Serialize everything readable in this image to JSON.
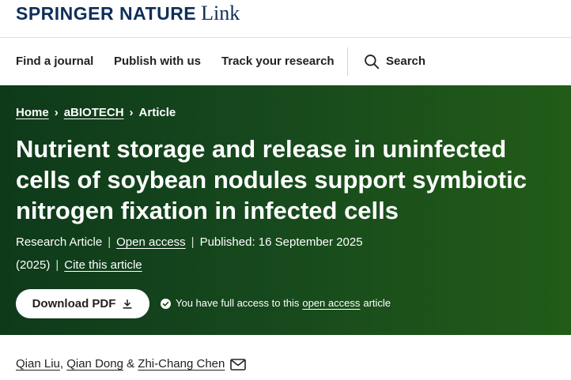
{
  "logo": {
    "brand": "SPRINGER NATURE",
    "sub": "Link"
  },
  "nav": {
    "items": [
      "Find a journal",
      "Publish with us",
      "Track your research"
    ],
    "search_label": "Search"
  },
  "breadcrumb": {
    "home": "Home",
    "journal": "aBIOTECH",
    "current": "Article",
    "separator": "›"
  },
  "article": {
    "title": "Nutrient storage and release in uninfected cells of soybean nodules support symbiotic nitrogen fixation in infected cells",
    "type": "Research Article",
    "access": "Open access",
    "published": "Published: 16 September 2025",
    "volume": "(2025)",
    "cite": "Cite this article"
  },
  "download": {
    "label": "Download PDF"
  },
  "access_note": {
    "prefix": "You have full access to this",
    "link": "open access",
    "suffix": "article"
  },
  "authors": {
    "list": [
      "Qian Liu",
      "Qian Dong",
      "Zhi-Chang Chen"
    ],
    "sep1": ",",
    "sep2": "&"
  },
  "colors": {
    "hero_dark": "#0e3a1a",
    "hero_light": "#225c18",
    "logo": "#0e2f5a"
  },
  "icons": [
    "search-icon",
    "chevron-right-icon",
    "download-icon",
    "check-circle-icon",
    "mail-icon"
  ]
}
